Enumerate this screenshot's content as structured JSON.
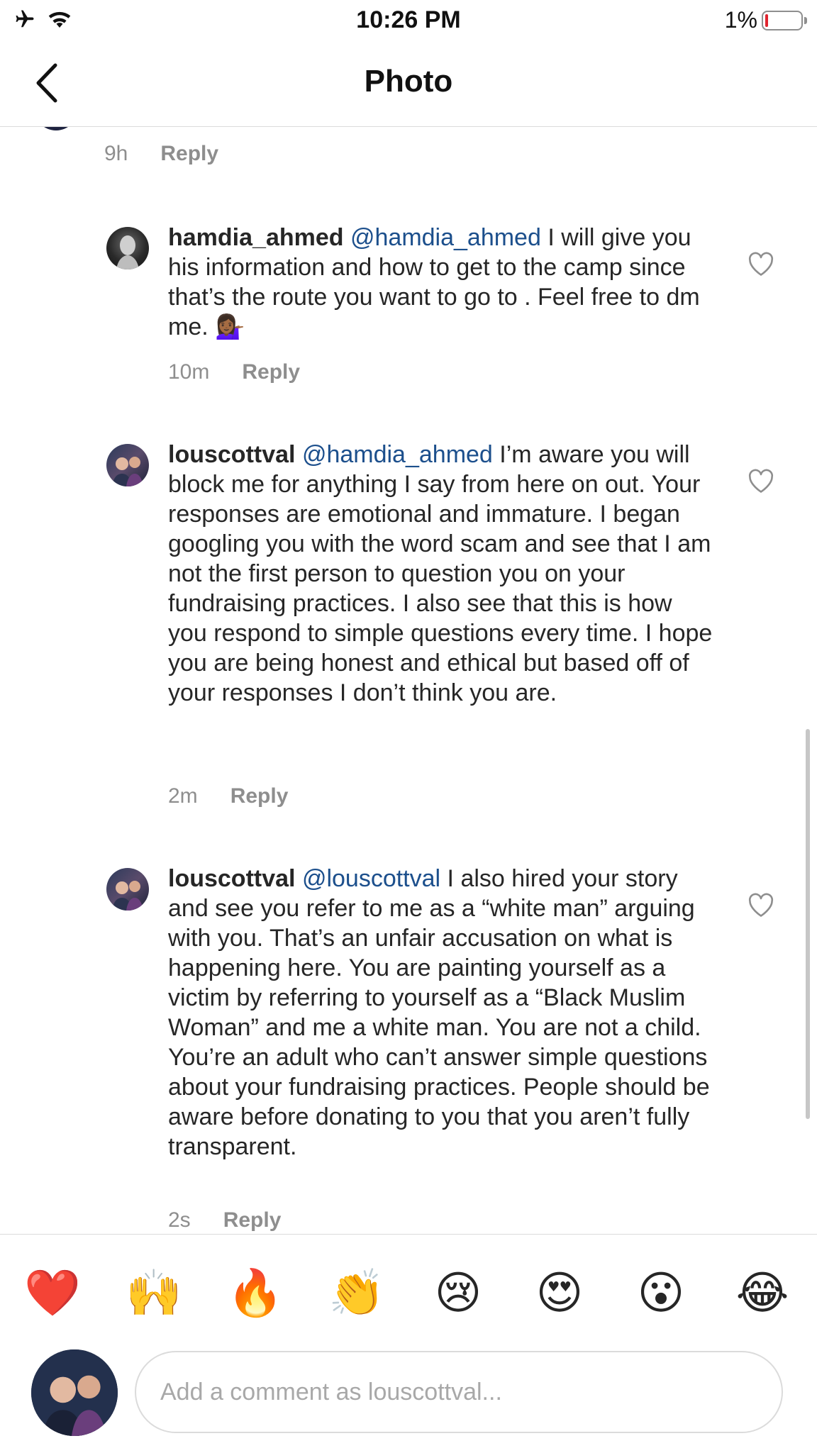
{
  "status_bar": {
    "time": "10:26 PM",
    "battery": "1%",
    "icons": [
      "airplane-icon",
      "wifi-icon",
      "battery-icon"
    ]
  },
  "nav": {
    "title": "Photo",
    "back_icon": "chevron-left-icon"
  },
  "prev_comment": {
    "time": "9h",
    "reply": "Reply"
  },
  "comments": [
    {
      "username": "hamdia_ahmed",
      "mention": "@hamdia_ahmed",
      "text": " I will give you his information and how to get to the camp since that’s the route you want to go to . Feel free to dm me.",
      "emoji": "💁🏾‍♀️",
      "time": "10m",
      "reply": "Reply"
    },
    {
      "username": "louscottval",
      "mention": "@hamdia_ahmed",
      "text": "I’m aware you will block me for anything I say from here on out. Your responses are emotional and immature. I began googling you with the word scam and see that I am not the first person to question you on your fundraising practices. I also see that this is how you respond to simple questions every time. I hope you are being honest and ethical but based off of your responses I don’t think you are.",
      "time": "2m",
      "reply": "Reply"
    },
    {
      "username": "louscottval",
      "mention": "@louscottval",
      "text": "I also hired your story and see you refer to me as a “white man” arguing with you. That’s an unfair accusation on what is happening here. You are painting yourself as a victim by referring to yourself as a “Black Muslim Woman” and me a white man.  You are not a child. You’re an adult who can’t answer simple questions about your fundraising practices. People should be aware before donating to you that you aren’t fully transparent.",
      "time": "2s",
      "reply": "Reply"
    }
  ],
  "emoji_bar": [
    "❤️",
    "🙌",
    "🔥",
    "👏",
    "😢",
    "😍",
    "😮",
    "😂"
  ],
  "composer": {
    "placeholder": "Add a comment as louscottval..."
  },
  "colors": {
    "mention": "#1c4f8c",
    "meta": "#8e8e8e",
    "divider": "#dbdbdb"
  }
}
